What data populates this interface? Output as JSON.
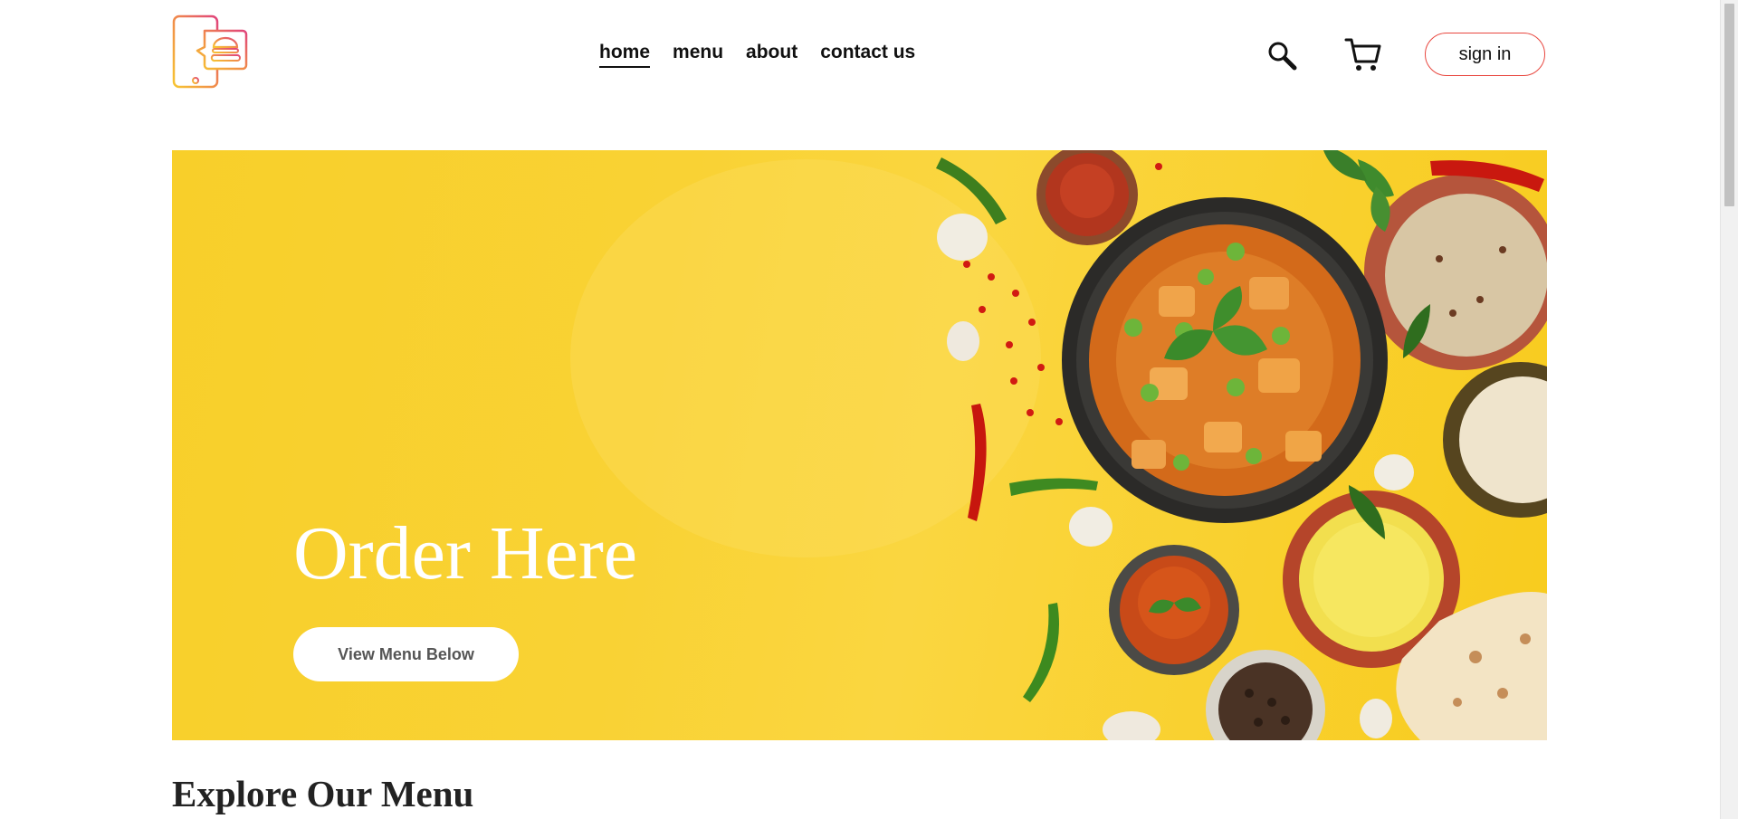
{
  "header": {
    "logo_icon": "food-delivery-phone-burger-logo",
    "nav": [
      {
        "label": "home",
        "active": true
      },
      {
        "label": "menu",
        "active": false
      },
      {
        "label": "about",
        "active": false
      },
      {
        "label": "contact us",
        "active": false
      }
    ],
    "search_icon": "search-icon",
    "cart_icon": "cart-icon",
    "signin_label": "sign in",
    "colors": {
      "signin_border": "#e8473f",
      "logo_gradient_start": "#f7c531",
      "logo_gradient_end": "#e0447c"
    }
  },
  "hero": {
    "title": "Order Here",
    "button_label": "View Menu Below",
    "background_color": "#f8cf2a",
    "image": "top-down Indian curry spread with rice, naan, spices and chillies on yellow background"
  },
  "menu_section": {
    "title": "Explore Our Menu"
  }
}
